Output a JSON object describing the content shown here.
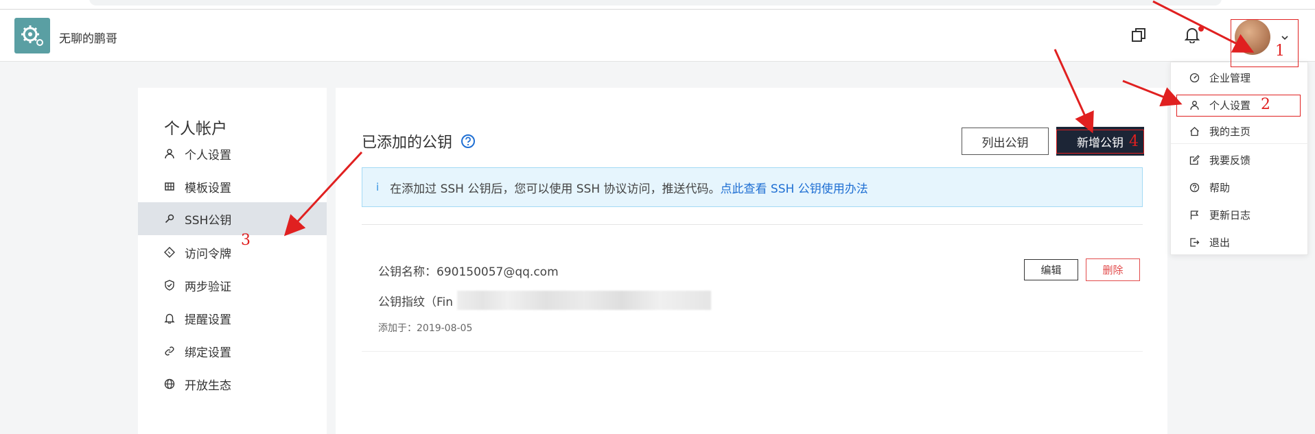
{
  "header": {
    "org_name": "无聊的鹏哥"
  },
  "sidebar": {
    "title": "个人帐户",
    "items": [
      {
        "label": "个人设置",
        "icon": "user-icon"
      },
      {
        "label": "模板设置",
        "icon": "grid-icon"
      },
      {
        "label": "SSH公钥",
        "icon": "key-search-icon",
        "active": true
      },
      {
        "label": "访问令牌",
        "icon": "ticket-icon"
      },
      {
        "label": "两步验证",
        "icon": "shield-icon"
      },
      {
        "label": "提醒设置",
        "icon": "bell-icon"
      },
      {
        "label": "绑定设置",
        "icon": "link-icon"
      },
      {
        "label": "开放生态",
        "icon": "globe-icon"
      }
    ]
  },
  "main": {
    "title": "已添加的公钥",
    "list_button": "列出公钥",
    "add_button": "新增公钥",
    "info": {
      "icon": "i",
      "text": "在添加过 SSH 公钥后，您可以使用 SSH 协议访问，推送代码。",
      "link": "点此查看 SSH 公钥使用办法"
    },
    "key": {
      "name_label": "公钥名称：",
      "name_value": "690150057@qq.com",
      "fingerprint_label": "公钥指纹（Fin",
      "added_label": "添加于：",
      "added_date": "2019-08-05",
      "edit_button": "编辑",
      "delete_button": "删除"
    }
  },
  "dropdown": {
    "items": [
      {
        "label": "企业管理",
        "icon": "dashboard-icon"
      },
      {
        "label": "个人设置",
        "icon": "user-icon"
      },
      {
        "label": "我的主页",
        "icon": "home-icon"
      },
      {
        "label": "我要反馈",
        "icon": "edit-icon"
      },
      {
        "label": "帮助",
        "icon": "help-circle-icon"
      },
      {
        "label": "更新日志",
        "icon": "flag-icon"
      },
      {
        "label": "退出",
        "icon": "logout-icon"
      }
    ]
  },
  "annotations": [
    "1",
    "2",
    "3",
    "4"
  ],
  "colors": {
    "accent_dark": "#1c2536",
    "annotation_red": "#e02020",
    "info_bg": "#e6f5fd",
    "link_blue": "#1f6fd3",
    "danger": "#e24a4a",
    "logo_teal": "#5a9fa3"
  }
}
